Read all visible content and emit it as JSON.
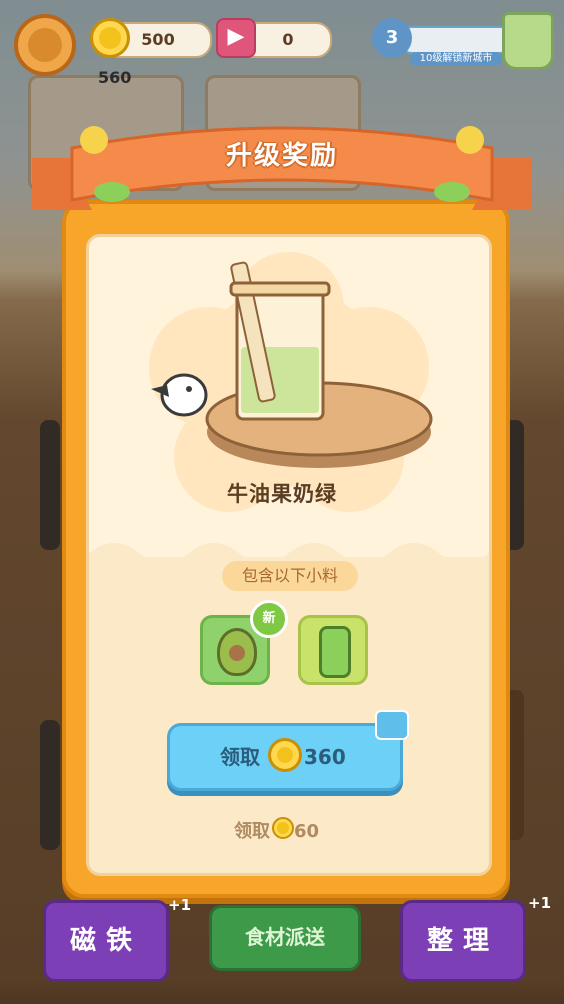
{
  "hud": {
    "coins": "500",
    "tickets": "0",
    "level": "3",
    "level_caption": "10级解锁新城市",
    "score": "560"
  },
  "modal": {
    "title": "升级奖励",
    "drink_name": "牛油果奶绿",
    "ingredients_label": "包含以下小料",
    "new_badge": "新",
    "claim_button_label": "领取",
    "claim_button_amount": "360",
    "small_claim_label": "领取",
    "small_claim_amount": "60"
  },
  "bottom": {
    "magnet_label": "磁铁",
    "delivery_label": "食材派送",
    "organize_label": "整理",
    "magnet_plus": "+1",
    "organize_plus": "+1"
  },
  "colors": {
    "modal_orange": "#f7a62a",
    "claim_blue": "#6dd0f6",
    "ribbon": "#f58b4a"
  }
}
